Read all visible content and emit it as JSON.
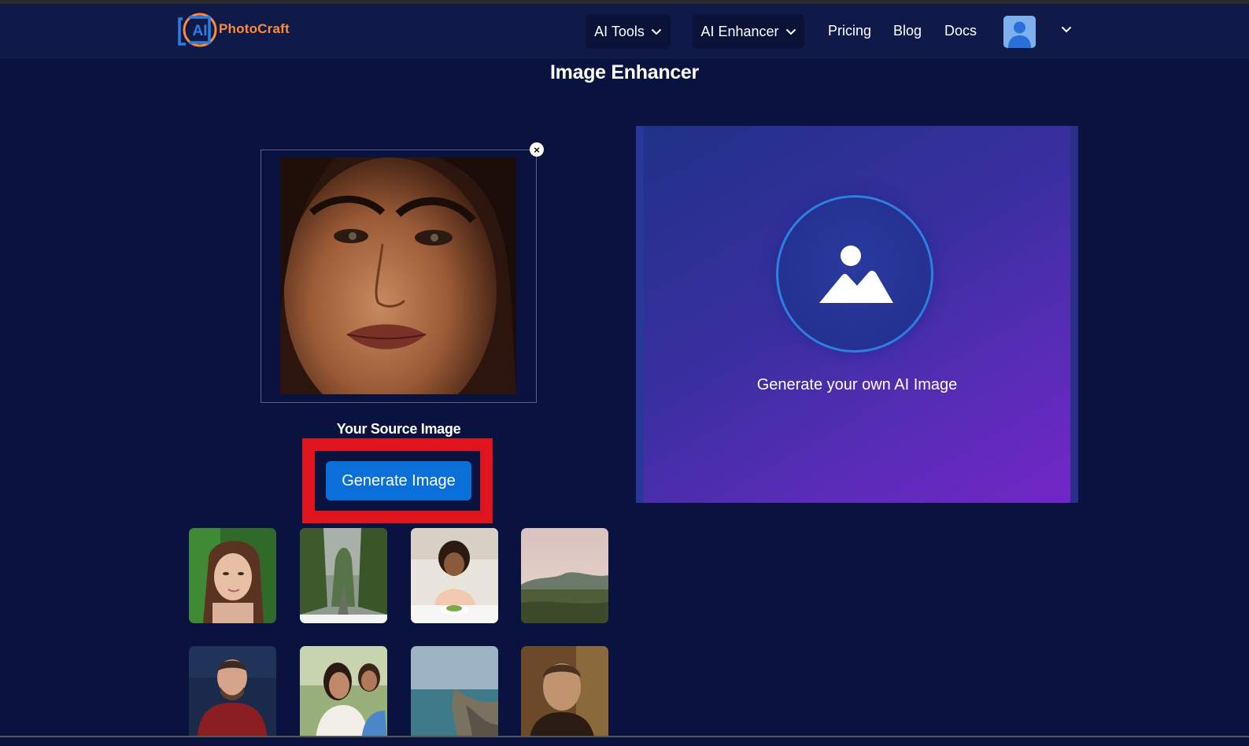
{
  "brand": {
    "logo_text": "PhotoCraft",
    "logo_badge": "AI",
    "accent": "#ff8a3a",
    "badge_color": "#2a7fe0"
  },
  "nav": {
    "ai_tools": "AI Tools",
    "ai_enhancer": "AI Enhancer",
    "pricing": "Pricing",
    "blog": "Blog",
    "docs": "Docs",
    "avatar_icon": "user-avatar-icon",
    "menu_icon": "chevron-down-icon"
  },
  "page": {
    "title": "Image Enhancer"
  },
  "source": {
    "label": "Your Source Image",
    "remove_icon": "close-icon",
    "remove_glyph": "×",
    "generate_label": "Generate Image"
  },
  "result": {
    "caption": "Generate your own AI Image",
    "icon": "image-placeholder-icon"
  },
  "samples": [
    {
      "name": "sample-woman-portrait",
      "caption": ""
    },
    {
      "name": "sample-forest-road",
      "caption": ""
    },
    {
      "name": "sample-woman-kitchen",
      "caption": ""
    },
    {
      "name": "sample-landscape-sunset",
      "caption": ""
    },
    {
      "name": "sample-man-smiling",
      "caption": ""
    },
    {
      "name": "sample-women-laughing",
      "caption": ""
    },
    {
      "name": "sample-coastline",
      "caption": ""
    },
    {
      "name": "sample-man-portrait",
      "caption": ""
    }
  ],
  "colors": {
    "background": "#0a1340",
    "navbar": "#0f1a48",
    "primary_button": "#0a6fd8",
    "highlight": "#e0141c",
    "panel_gradient_start": "#1f3187",
    "panel_gradient_end": "#7426c8"
  }
}
